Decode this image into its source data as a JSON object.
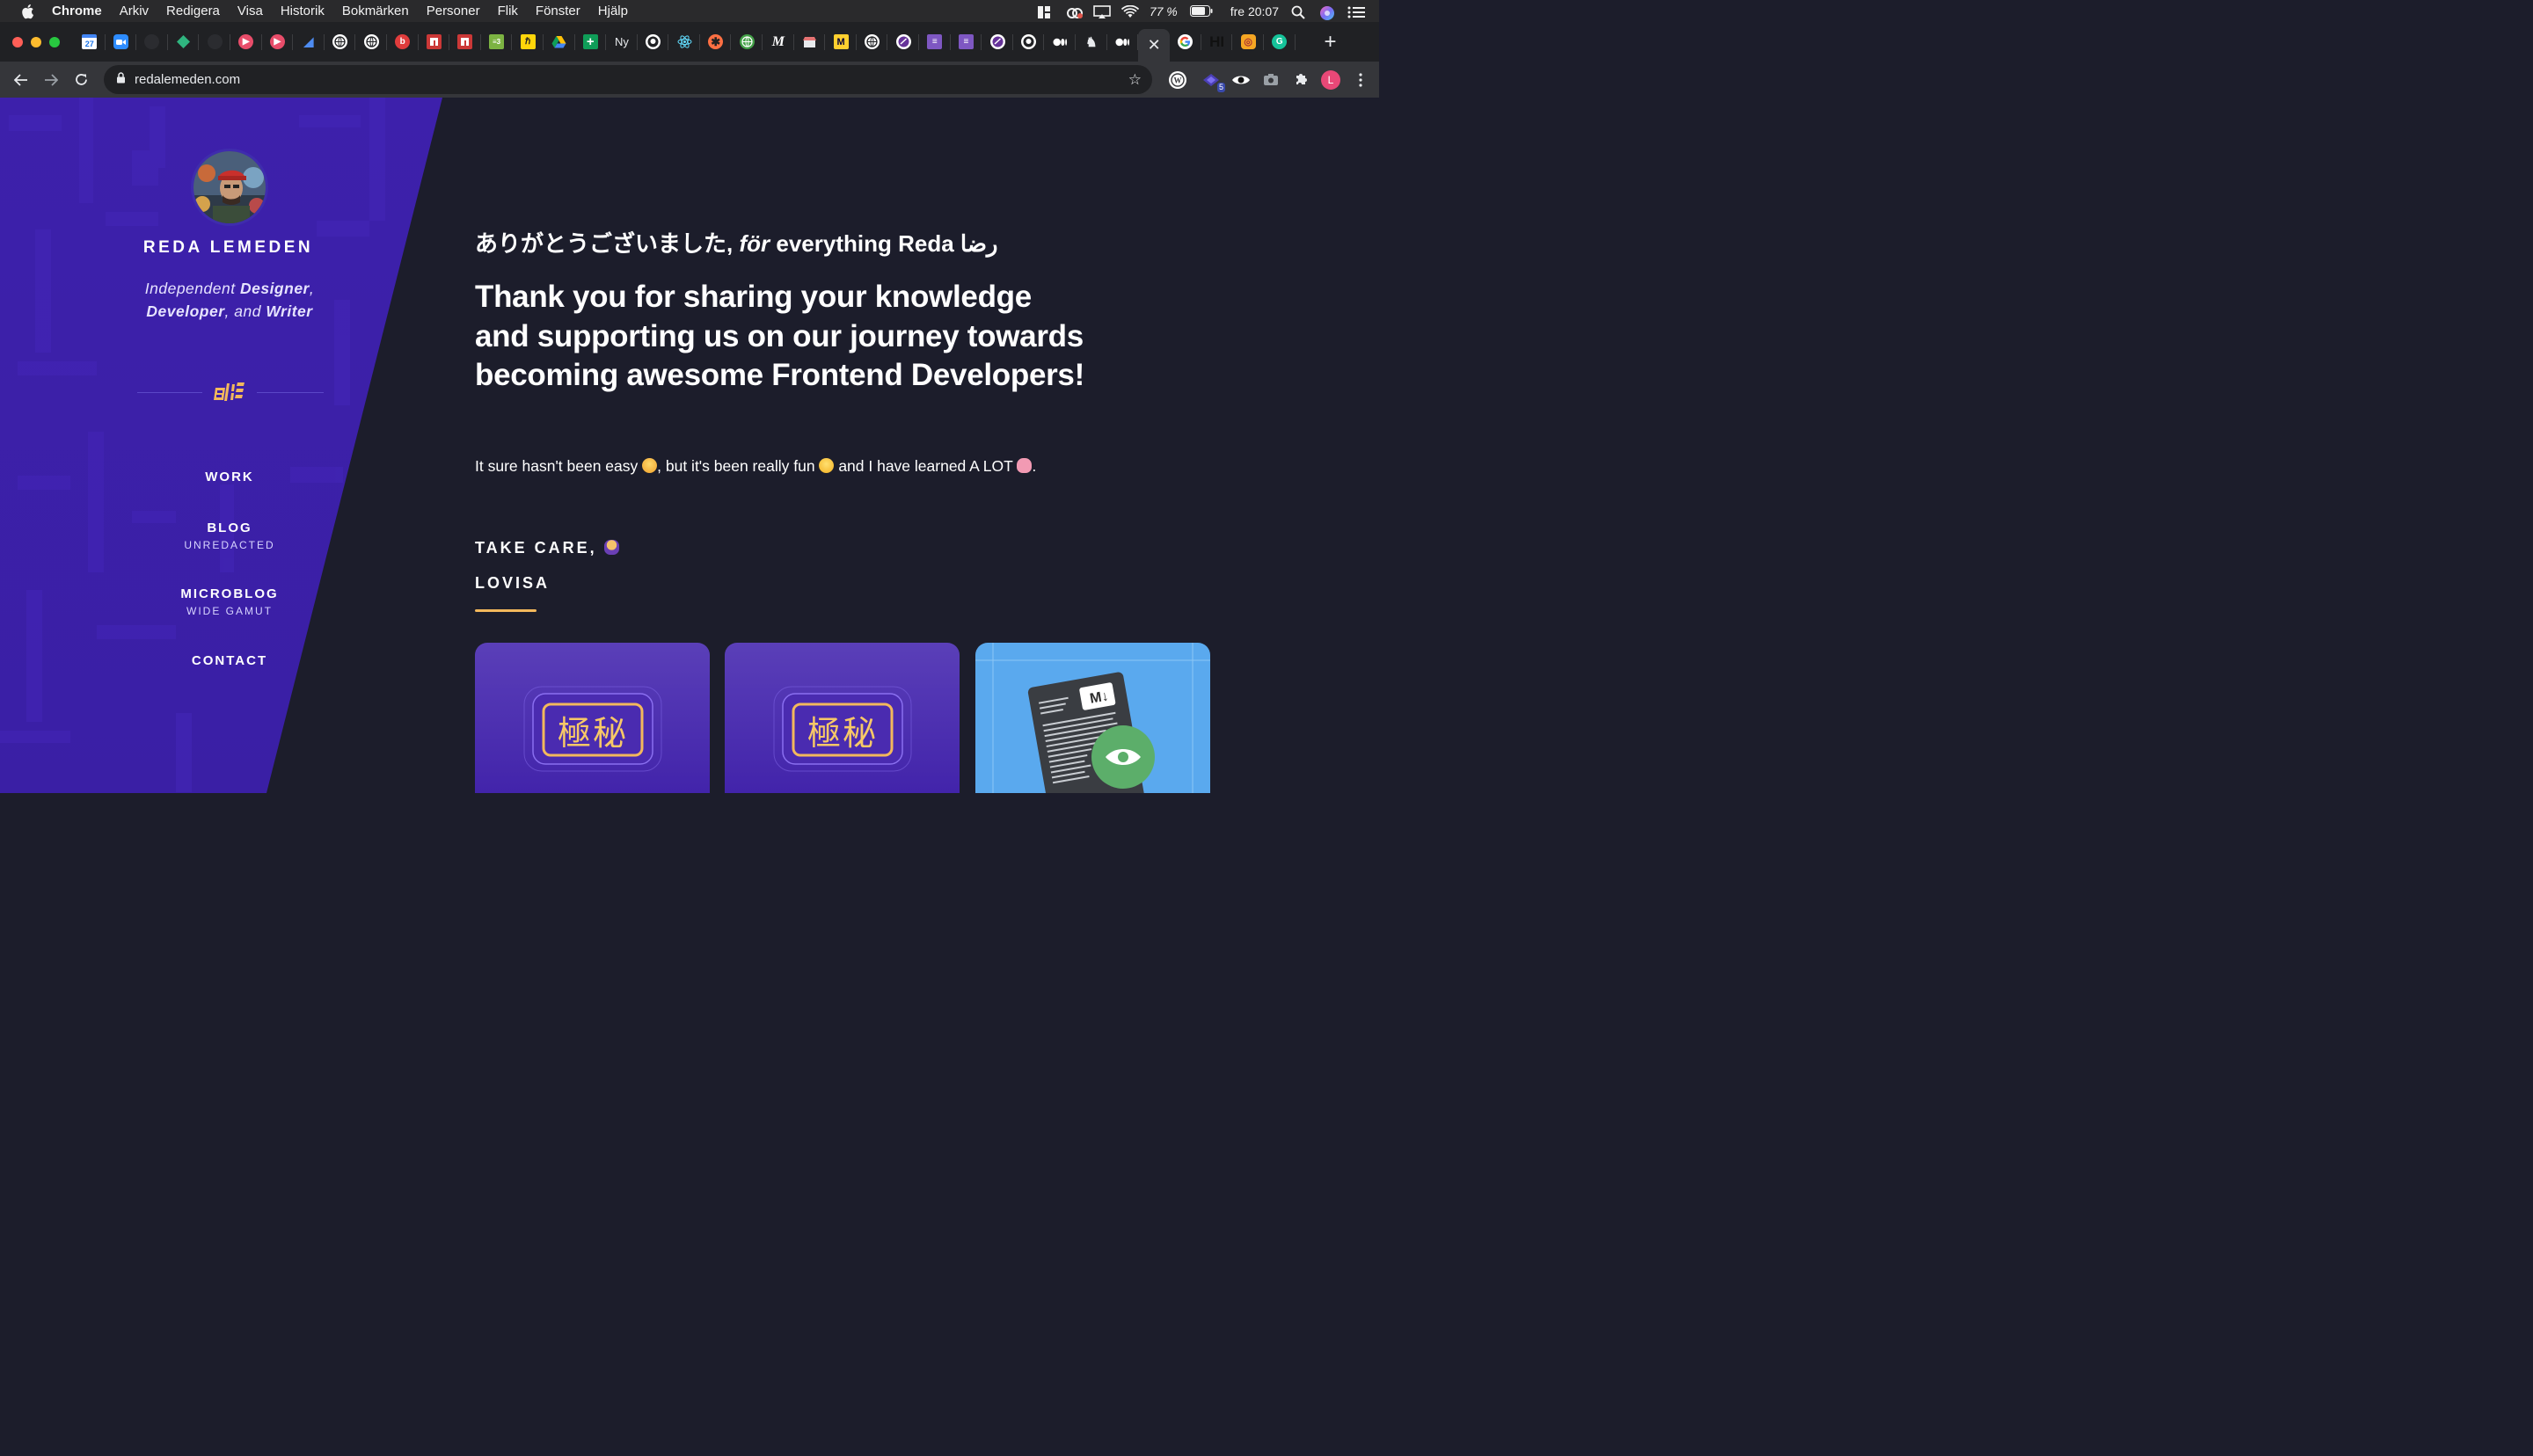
{
  "menubar": {
    "apple_icon": "apple-icon",
    "app_name": "Chrome",
    "menus": [
      "Arkiv",
      "Redigera",
      "Visa",
      "Historik",
      "Bokmärken",
      "Personer",
      "Flik",
      "Fönster",
      "Hjälp"
    ],
    "battery": "77 %",
    "clock": "fre 20:07"
  },
  "tabs": {
    "text_favicon_label": "Ny",
    "active_close": "✕",
    "new_tab": "+"
  },
  "toolbar": {
    "url": "redalemeden.com",
    "extension_badge": "5",
    "profile_initial": "L"
  },
  "sidebar": {
    "site_name": "REDA LEMEDEN",
    "tagline": {
      "w1": "Independent",
      "w2": "Designer",
      "w3": ",",
      "w4": "Developer",
      "w5": ", and",
      "w6": "Writer"
    },
    "nav": [
      {
        "label": "WORK",
        "sub": ""
      },
      {
        "label": "BLOG",
        "sub": "UNREDACTED"
      },
      {
        "label": "MICROBLOG",
        "sub": "WIDE GAMUT"
      },
      {
        "label": "CONTACT",
        "sub": ""
      }
    ]
  },
  "main": {
    "greeting_jp": "ありがとうございました,",
    "greeting_for": "för",
    "greeting_rest": "everything Reda",
    "greeting_ar": "رضا",
    "headline": "Thank you for sharing your knowledge and supporting us on our journey towards becoming awesome Frontend Developers!",
    "lead_1": "It sure hasn't been easy",
    "lead_2": ", but it's been really fun",
    "lead_3": "and I have learned A LOT",
    "lead_4": ".",
    "signoff": "TAKE CARE,",
    "name": "LOVISA",
    "card_kanji": "極秘",
    "card_md": "M↓"
  },
  "colors": {
    "sidebar": "#3b1fa9",
    "background": "#1c1d2b",
    "accent": "#f3b85c"
  }
}
